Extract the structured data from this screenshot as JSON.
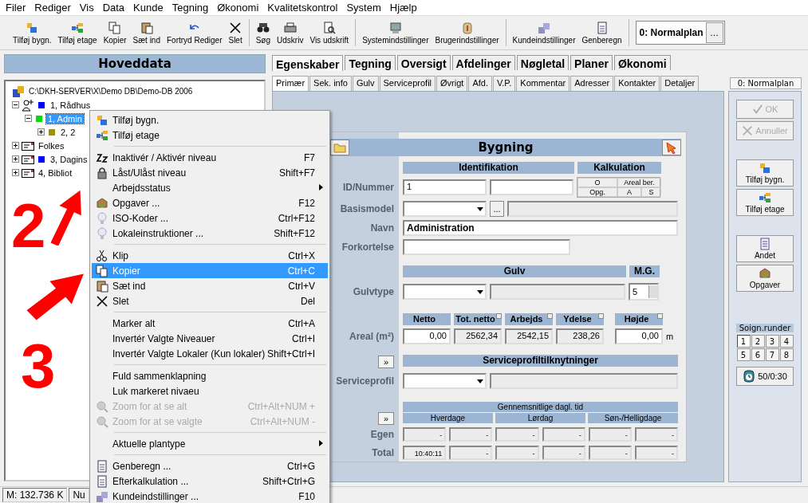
{
  "menu_bar": [
    {
      "label": "Filer"
    },
    {
      "label": "Rediger"
    },
    {
      "label": "Vis"
    },
    {
      "label": "Data"
    },
    {
      "label": "Kunde"
    },
    {
      "label": "Tegning"
    },
    {
      "label": "Økonomi"
    },
    {
      "label": "Kvalitetskontrol"
    },
    {
      "label": "System"
    },
    {
      "label": "Hjælp"
    }
  ],
  "toolbar": {
    "groups": [
      [
        {
          "label": "Tilføj bygn."
        },
        {
          "label": "Tilføj etage"
        },
        {
          "label": "Kopier"
        },
        {
          "label": "Sæt ind"
        },
        {
          "label": "Fortryd Rediger"
        },
        {
          "label": "Slet"
        }
      ],
      [
        {
          "label": "Søg"
        },
        {
          "label": "Udskriv"
        },
        {
          "label": "Vis udskrift"
        }
      ],
      [
        {
          "label": "Systemindstillinger"
        },
        {
          "label": "Brugerindstillinger"
        }
      ],
      [
        {
          "label": "Kundeindstillinger"
        },
        {
          "label": "Genberegn"
        }
      ]
    ],
    "plan": "0: Normalplan",
    "plan_button": "..."
  },
  "left_panel": {
    "title": "Hoveddata",
    "tree": {
      "label": "C:\\DKH-SERVER\\X\\Demo DB\\Demo-DB 2006",
      "children": [
        {
          "label": "1, Rådhus",
          "color": "#0000ff",
          "expanded": true,
          "selected": false,
          "children": [
            {
              "label": "1, Admin",
              "color": "#00e000",
              "expanded": true,
              "selected": true,
              "children": [
                {
                  "label": "2, 2",
                  "color": "#a09000",
                  "expanded": false,
                  "selected": false
                }
              ]
            }
          ]
        },
        {
          "label": "Folkes",
          "expanded": false,
          "selected": false
        },
        {
          "label": "3, Dagins",
          "color": "#0000ff",
          "expanded": false,
          "selected": false
        },
        {
          "label": "4, Bibliot",
          "expanded": false,
          "selected": false
        }
      ]
    }
  },
  "tabs": [
    {
      "label": "Egenskaber",
      "selected": true
    },
    {
      "label": "Tegning",
      "selected": false
    },
    {
      "label": "Oversigt",
      "selected": false
    },
    {
      "label": "Afdelinger",
      "selected": false
    },
    {
      "label": "Nøgletal",
      "selected": false
    },
    {
      "label": "Planer",
      "selected": false
    },
    {
      "label": "Økonomi",
      "selected": false
    }
  ],
  "subtabs": [
    {
      "label": "Primær",
      "selected": true
    },
    {
      "label": "Sek. info",
      "selected": false
    },
    {
      "label": "Gulv",
      "selected": false
    },
    {
      "label": "Serviceprofil",
      "selected": false
    },
    {
      "label": "Øvrigt",
      "selected": false
    },
    {
      "label": "Afd.",
      "selected": false
    },
    {
      "label": "V.P.",
      "selected": false
    },
    {
      "label": "Kommentar",
      "selected": false
    },
    {
      "label": "Adresser",
      "selected": false
    },
    {
      "label": "Kontakter",
      "selected": false
    },
    {
      "label": "Detaljer",
      "selected": false
    }
  ],
  "form": {
    "title": "Bygning",
    "identification": {
      "header": "Identifikation",
      "id_label": "ID/Nummer",
      "id_value": "1",
      "basismodel_label": "Basismodel",
      "basismodel_button": "...",
      "navn_label": "Navn",
      "navn_value": "Administration",
      "forkortelse_label": "Forkortelse"
    },
    "kalkulation": {
      "header": "Kalkulation",
      "cells": [
        "O",
        "Areal ber.",
        "Opg.",
        "A",
        "S"
      ]
    },
    "gulv": {
      "header": "Gulv",
      "mg_header": "M.G.",
      "label": "Gulvtype",
      "mg_value": "5"
    },
    "areal": {
      "label": "Areal (m²)",
      "unit": "m",
      "columns": [
        {
          "header": "Netto",
          "value": "0,00",
          "editable": true,
          "marker": false
        },
        {
          "header": "Tot. netto",
          "value": "2562,34",
          "editable": false,
          "marker": true
        },
        {
          "header": "Arbejds",
          "value": "2542,15",
          "editable": false,
          "marker": true
        },
        {
          "header": "Ydelse",
          "value": "238,26",
          "editable": false,
          "marker": true
        },
        {
          "header": "Højde",
          "value": "0,00",
          "editable": true,
          "marker": true
        }
      ]
    },
    "serviceprofil": {
      "expand_button": "»",
      "header": "Serviceprofiltilknytninger",
      "label": "Serviceprofil"
    },
    "daily_time": {
      "expand_button": "»",
      "header": "Gennemsnitlige dagl. tid",
      "groups": [
        "Hverdage",
        "Lørdag",
        "Søn-/Helligdage"
      ],
      "rows": [
        {
          "label": "Egen",
          "cells": [
            "-",
            "-",
            "-",
            "-",
            "-",
            "-"
          ]
        },
        {
          "label": "Total",
          "cells": [
            "10:40:11",
            "-",
            "-",
            "-",
            "-",
            "-"
          ]
        }
      ]
    }
  },
  "right_panel": {
    "plan": "0: Normalplan",
    "buttons": [
      {
        "label": "OK",
        "disabled": true
      },
      {
        "label": "Annuller",
        "disabled": true
      }
    ],
    "actions": [
      {
        "label": "Tilføj bygn."
      },
      {
        "label": "Tilføj etage"
      }
    ],
    "more": [
      {
        "label": "Andet"
      },
      {
        "label": "Opgaver"
      }
    ],
    "rounds_label": "Soign.runder",
    "rounds": [
      {
        "label": "1",
        "selected": true
      },
      {
        "label": "2",
        "selected": false
      },
      {
        "label": "3",
        "selected": false
      },
      {
        "label": "4",
        "selected": false
      },
      {
        "label": "5",
        "selected": false
      },
      {
        "label": "6",
        "selected": false
      },
      {
        "label": "7",
        "selected": false
      },
      {
        "label": "8",
        "selected": false
      }
    ],
    "timer": "50/0:30"
  },
  "status_bar": [
    "M: 132.736 K",
    "Nu"
  ],
  "context_menu": {
    "groups": [
      {
        "items": [
          {
            "label": "Tilføj bygn.",
            "selected": false,
            "disabled": false,
            "submenu": false
          },
          {
            "label": "Tilføj etage",
            "selected": false,
            "disabled": false,
            "submenu": false
          }
        ]
      },
      {
        "items": [
          {
            "label": "Inaktivér / Aktivér niveau",
            "shortcut": "F7",
            "selected": false,
            "disabled": false,
            "submenu": false
          },
          {
            "label": "Låst/Ulåst niveau",
            "shortcut": "Shift+F7",
            "selected": false,
            "disabled": false,
            "submenu": false
          },
          {
            "label": "Arbejdsstatus",
            "selected": false,
            "disabled": false,
            "submenu": true
          },
          {
            "label": "Opgaver ...",
            "shortcut": "F12",
            "selected": false,
            "disabled": false,
            "submenu": false
          },
          {
            "label": "ISO-Koder ...",
            "shortcut": "Ctrl+F12",
            "selected": false,
            "disabled": false,
            "submenu": false
          },
          {
            "label": "Lokaleinstruktioner ...",
            "shortcut": "Shift+F12",
            "selected": false,
            "disabled": false,
            "submenu": false
          }
        ]
      },
      {
        "items": [
          {
            "label": "Klip",
            "shortcut": "Ctrl+X",
            "selected": false,
            "disabled": false,
            "submenu": false
          },
          {
            "label": "Kopier",
            "shortcut": "Ctrl+C",
            "selected": true,
            "disabled": false,
            "submenu": false
          },
          {
            "label": "Sæt ind",
            "shortcut": "Ctrl+V",
            "selected": false,
            "disabled": false,
            "submenu": false
          },
          {
            "label": "Slet",
            "shortcut": "Del",
            "selected": false,
            "disabled": false,
            "submenu": false
          }
        ]
      },
      {
        "items": [
          {
            "label": "Marker alt",
            "shortcut": "Ctrl+A",
            "selected": false,
            "disabled": false,
            "submenu": false
          },
          {
            "label": "Invertér Valgte Niveauer",
            "shortcut": "Ctrl+I",
            "selected": false,
            "disabled": false,
            "submenu": false
          },
          {
            "label": "Invertér Valgte Lokaler (Kun lokaler)",
            "shortcut": "Shift+Ctrl+I",
            "selected": false,
            "disabled": false,
            "submenu": false
          }
        ]
      },
      {
        "items": [
          {
            "label": "Fuld sammenklapning",
            "selected": false,
            "disabled": false,
            "submenu": false
          },
          {
            "label": "Luk markeret nivaeu",
            "selected": false,
            "disabled": false,
            "submenu": false
          },
          {
            "label": "Zoom for at se alt",
            "shortcut": "Ctrl+Alt+NUM +",
            "selected": false,
            "disabled": true,
            "submenu": false
          },
          {
            "label": "Zoom for at se valgte",
            "shortcut": "Ctrl+Alt+NUM -",
            "selected": false,
            "disabled": true,
            "submenu": false
          }
        ]
      },
      {
        "items": [
          {
            "label": "Aktuelle plantype",
            "selected": false,
            "disabled": false,
            "submenu": true
          }
        ]
      },
      {
        "items": [
          {
            "label": "Genberegn ...",
            "shortcut": "Ctrl+G",
            "selected": false,
            "disabled": false,
            "submenu": false
          },
          {
            "label": "Efterkalkulation ...",
            "shortcut": "Shift+Ctrl+G",
            "selected": false,
            "disabled": false,
            "submenu": false
          },
          {
            "label": "Kundeindstillinger ...",
            "shortcut": "F10",
            "selected": false,
            "disabled": false,
            "submenu": false
          }
        ]
      }
    ]
  },
  "annotations": [
    {
      "text": "2"
    },
    {
      "text": "3"
    }
  ]
}
